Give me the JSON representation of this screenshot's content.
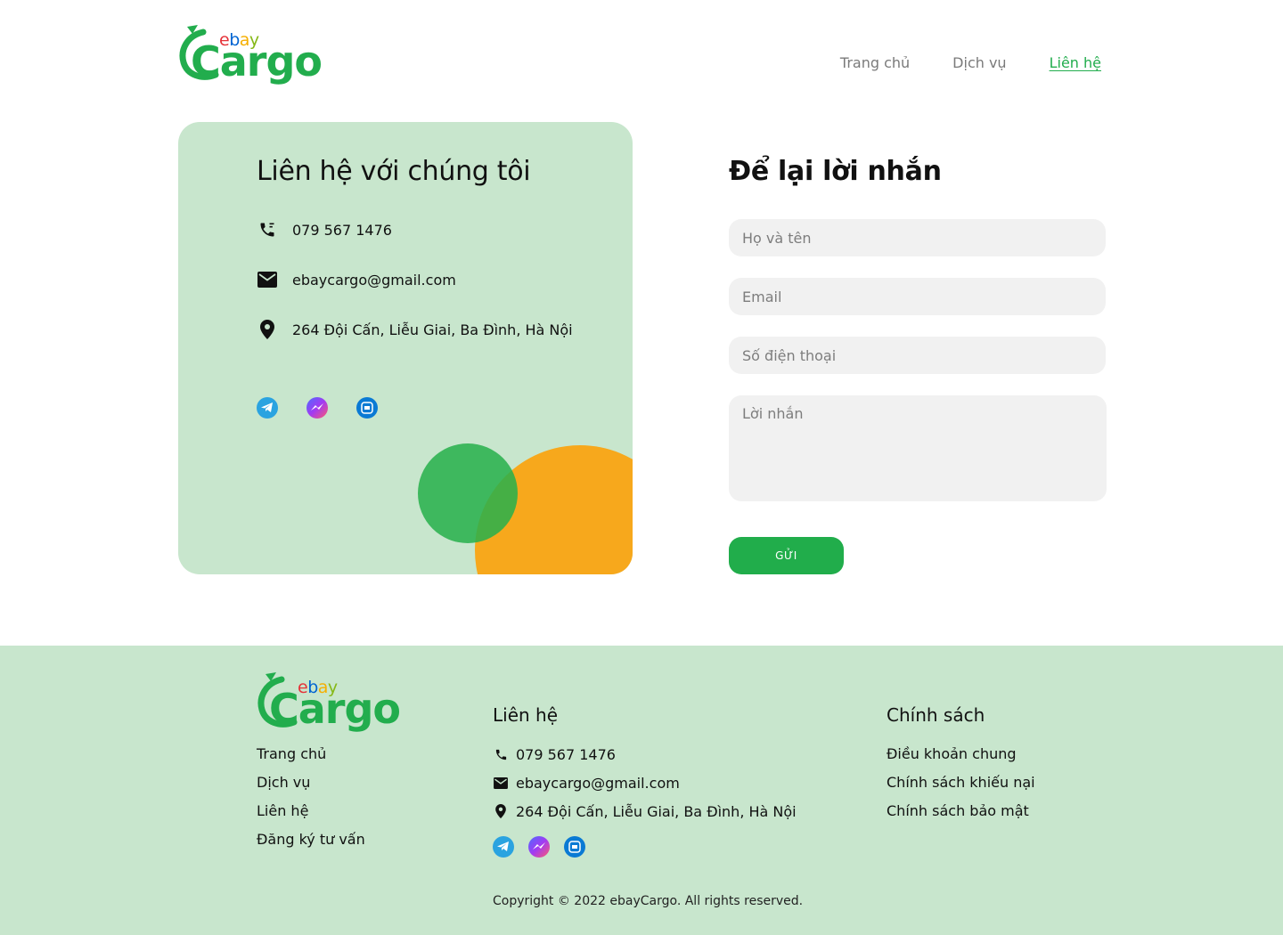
{
  "brand": {
    "ebay": [
      "e",
      "b",
      "a",
      "y"
    ],
    "ebay_colors": [
      "#e53238",
      "#0064d2",
      "#f5af02",
      "#86b817"
    ],
    "cargo": "Cargo",
    "primary_color": "#22ad4d",
    "card_color": "#c8e6cd",
    "accent_orange": "#f7a81c"
  },
  "nav": {
    "home": "Trang chủ",
    "services": "Dịch vụ",
    "contact": "Liên hệ",
    "active": "contact"
  },
  "contact_card": {
    "title": "Liên hệ với chúng tôi",
    "phone": "079 567 1476",
    "email": "ebaycargo@gmail.com",
    "address": "264 Đội Cấn, Liễu Giai, Ba Đình, Hà Nội",
    "icons": [
      "phone-icon",
      "mail-icon",
      "location-icon"
    ],
    "social": [
      "telegram-icon",
      "messenger-icon",
      "zalo-icon"
    ]
  },
  "form": {
    "title": "Để lại lời nhắn",
    "name_placeholder": "Họ và tên",
    "email_placeholder": "Email",
    "phone_placeholder": "Số điện thoại",
    "message_placeholder": "Lời nhắn",
    "submit_label": "GỬI"
  },
  "footer": {
    "links": [
      "Trang chủ",
      "Dịch vụ",
      "Liên hệ",
      "Đăng ký tư vấn"
    ],
    "contact_title": "Liên hệ",
    "phone": "079 567 1476",
    "email": "ebaycargo@gmail.com",
    "address": "264 Đội Cấn, Liễu Giai, Ba Đình, Hà Nội",
    "policy_title": "Chính sách",
    "policies": [
      "Điều khoản chung",
      "Chính sách khiếu nại",
      "Chính sách bảo mật"
    ],
    "copyright": "Copyright © 2022 ebayCargo. All rights reserved."
  }
}
